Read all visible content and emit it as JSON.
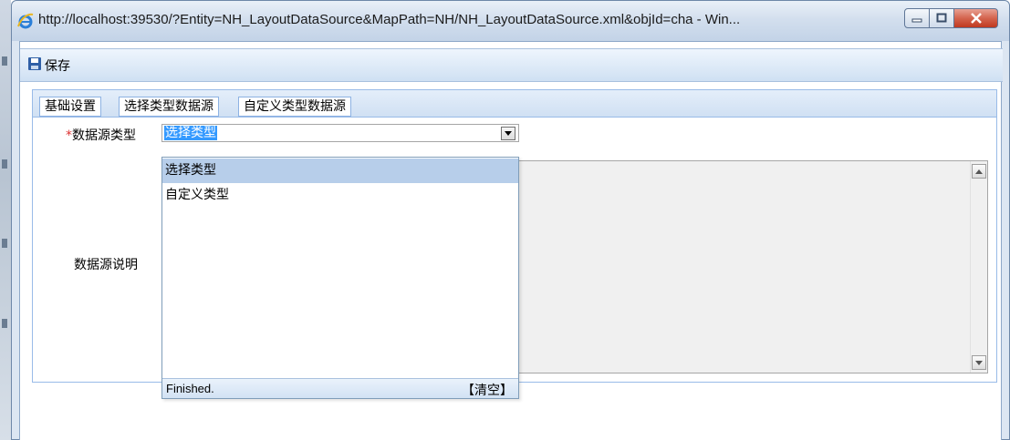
{
  "window": {
    "title": "http://localhost:39530/?Entity=NH_LayoutDataSource&MapPath=NH/NH_LayoutDataSource.xml&objId=cha - Win..."
  },
  "toolbar": {
    "save_label": "保存"
  },
  "tabs": [
    {
      "label": "基础设置"
    },
    {
      "label": "选择类型数据源"
    },
    {
      "label": "自定义类型数据源"
    }
  ],
  "form": {
    "required_mark": "*",
    "datasource_type_label": "数据源类型",
    "datasource_type_value": "选择类型",
    "datasource_desc_label": "数据源说明"
  },
  "dropdown": {
    "options": [
      "选择类型",
      "自定义类型"
    ],
    "selected_index": 0,
    "status_text": "Finished.",
    "clear_label": "【清空】"
  },
  "colors": {
    "close_button": "#c0391f",
    "selection_highlight": "#3399ff",
    "dropdown_selected": "#b7ceea",
    "required_star": "#dd3333"
  }
}
